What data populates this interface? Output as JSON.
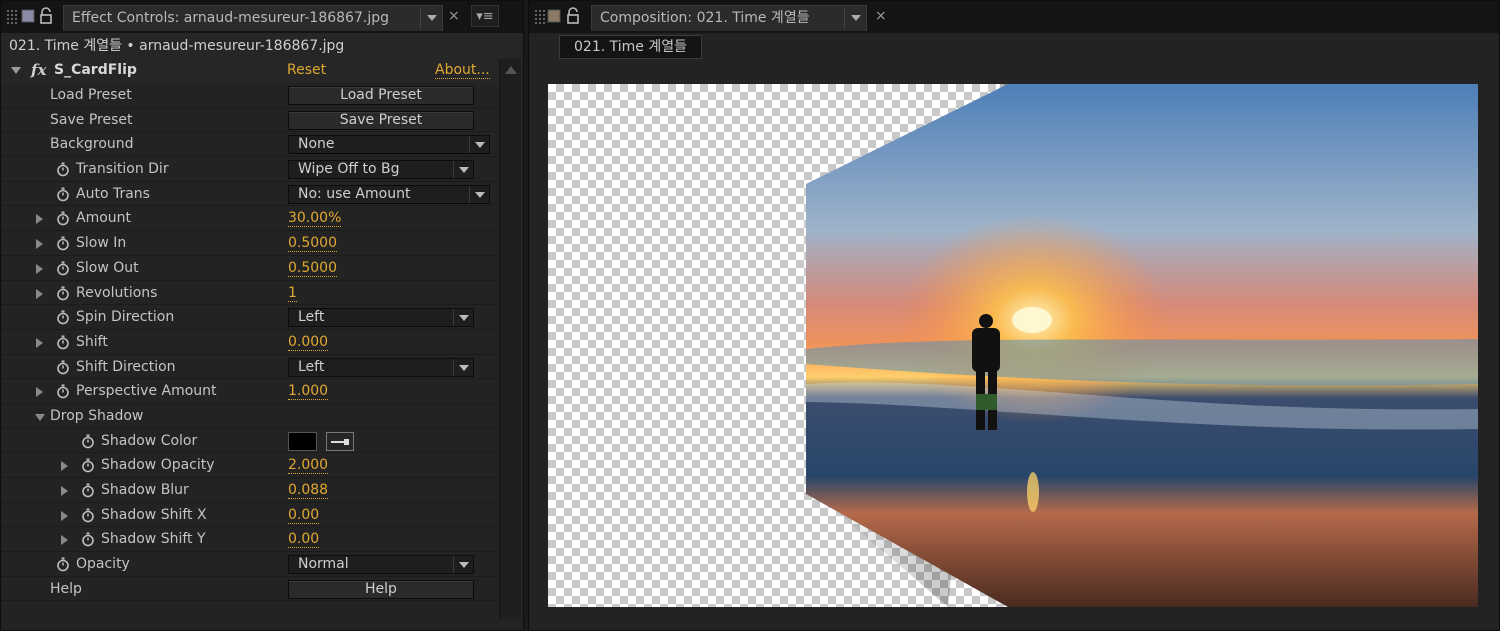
{
  "effect_panel": {
    "tab_title": "Effect Controls: arnaud-mesureur-186867.jpg",
    "close": "×",
    "menu": "▾≡",
    "layer_path": "021. Time 계열들 • arnaud-mesureur-186867.jpg",
    "effect": {
      "fx": "fx",
      "name": "S_CardFlip",
      "reset": "Reset",
      "about": "About..."
    },
    "rows": [
      {
        "name": "Load Preset",
        "button": "Load Preset"
      },
      {
        "name": "Save Preset",
        "button": "Save Preset"
      },
      {
        "name": "Background",
        "select": "None"
      },
      {
        "name": "Transition Dir",
        "select": "Wipe Off to Bg"
      },
      {
        "name": "Auto Trans",
        "select": "No: use Amount"
      },
      {
        "name": "Amount",
        "value": "30.00%"
      },
      {
        "name": "Slow In",
        "value": "0.5000"
      },
      {
        "name": "Slow Out",
        "value": "0.5000"
      },
      {
        "name": "Revolutions",
        "value": "1"
      },
      {
        "name": "Spin Direction",
        "select": "Left"
      },
      {
        "name": "Shift",
        "value": "0.000"
      },
      {
        "name": "Shift Direction",
        "select": "Left"
      },
      {
        "name": "Perspective Amount",
        "value": "1.000"
      },
      {
        "name": "Drop Shadow"
      },
      {
        "name": "Shadow Color",
        "color": "#000000"
      },
      {
        "name": "Shadow Opacity",
        "value": "2.000"
      },
      {
        "name": "Shadow Blur",
        "value": "0.088"
      },
      {
        "name": "Shadow Shift X",
        "value": "0.00"
      },
      {
        "name": "Shadow Shift Y",
        "value": "0.00"
      },
      {
        "name": "Opacity",
        "select": "Normal"
      },
      {
        "name": "Help",
        "button": "Help"
      }
    ]
  },
  "comp_panel": {
    "tab_title": "Composition: 021. Time 계열들",
    "close": "×",
    "comp_name": "021. Time 계열들"
  },
  "colors": {
    "accent_value": "#e0a832",
    "panel_bg": "#232323",
    "tab_bg": "#141414",
    "comp_label": "#8a7a66"
  },
  "icons": [
    "grip-icon",
    "lock-icon",
    "stopwatch-icon",
    "twirl-triangle-icon",
    "dropdown-arrow-icon",
    "eyedropper-icon",
    "close-icon",
    "panel-menu-icon",
    "scroll-up-icon"
  ]
}
